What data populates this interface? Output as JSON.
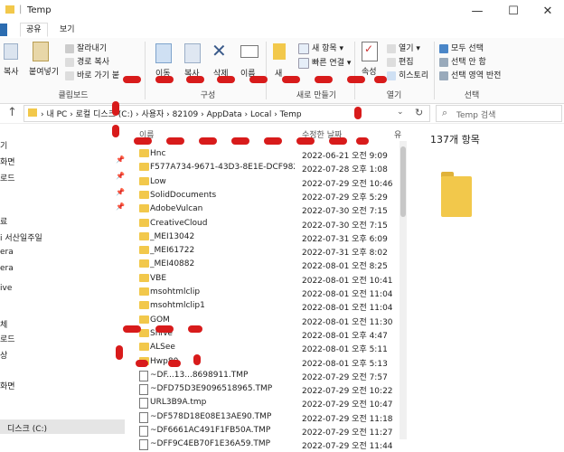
{
  "window": {
    "title": "Temp",
    "minimize": "—",
    "maximize": "☐",
    "close": "✕"
  },
  "tabs": [
    {
      "label": "공유"
    },
    {
      "label": "보기"
    }
  ],
  "ribbon": {
    "left_partial": [
      "복사",
      "붙여넣기"
    ],
    "clipboard_items": [
      "잘라내기",
      "경로 복사",
      "바로 가기 붙"
    ],
    "clipboard_label": "클립보드",
    "organize_items": [
      "이동",
      "복사",
      "삭제",
      "이름"
    ],
    "organize_label": "구성",
    "new_partial": "새",
    "new_item": "새 항목 ▾",
    "quick_access": "빠른 연결 ▾",
    "new_label": "새로 만들기",
    "properties": "속성",
    "open_items": [
      "열기 ▾",
      "편집",
      "히스토리"
    ],
    "open_label": "열기",
    "select_items": [
      "모두 선택",
      "선택 안 함",
      "선택 영역 반전"
    ],
    "select_label": "선택"
  },
  "address": {
    "path": [
      "내 PC",
      "로컬 디스크 (C:)",
      "사용자",
      "82109",
      "AppData",
      "Local",
      "Temp"
    ],
    "search_placeholder": "Temp 검색"
  },
  "nav": [
    {
      "label": "기",
      "pinned": false
    },
    {
      "label": "화면",
      "pinned": true
    },
    {
      "label": "로드",
      "pinned": true
    },
    {
      "label": "",
      "pinned": true
    },
    {
      "label": "",
      "pinned": true
    },
    {
      "label": "료",
      "pinned": false
    },
    {
      "label": "i 서산일주일",
      "pinned": false
    },
    {
      "label": "era",
      "pinned": false
    },
    {
      "label": "era",
      "pinned": false
    },
    {
      "label": "ive",
      "pinned": false
    },
    {
      "label": "체",
      "pinned": false
    },
    {
      "label": "로드",
      "pinned": false
    },
    {
      "label": "상",
      "pinned": false
    },
    {
      "label": "화면",
      "pinned": false
    },
    {
      "label": "디스크 (C:)",
      "pinned": false
    }
  ],
  "columns": {
    "name": "이름",
    "date": "수정한 날짜",
    "type": "유"
  },
  "files": [
    {
      "name": "Hnc",
      "date": "2022-06-21 오전 9:09",
      "kind": "folder"
    },
    {
      "name": "F577A734-9671-43D3-8E1E-DCF9820...",
      "date": "2022-07-28 오후 1:08",
      "kind": "folder"
    },
    {
      "name": "Low",
      "date": "2022-07-29 오전 10:46",
      "kind": "folder"
    },
    {
      "name": "SolidDocuments",
      "date": "2022-07-29 오후 5:29",
      "kind": "folder"
    },
    {
      "name": "AdobeVulcan",
      "date": "2022-07-30 오전 7:15",
      "kind": "folder"
    },
    {
      "name": "CreativeCloud",
      "date": "2022-07-30 오전 7:15",
      "kind": "folder"
    },
    {
      "name": "_MEI13042",
      "date": "2022-07-31 오후 6:09",
      "kind": "folder"
    },
    {
      "name": "_MEI61722",
      "date": "2022-07-31 오후 8:02",
      "kind": "folder"
    },
    {
      "name": "_MEI40882",
      "date": "2022-08-01 오전 8:25",
      "kind": "folder"
    },
    {
      "name": "VBE",
      "date": "2022-08-01 오전 10:41",
      "kind": "folder"
    },
    {
      "name": "msohtmlclip",
      "date": "2022-08-01 오전 11:04",
      "kind": "folder"
    },
    {
      "name": "msohtmlclip1",
      "date": "2022-08-01 오전 11:04",
      "kind": "folder"
    },
    {
      "name": "GOM",
      "date": "2022-08-01 오전 11:30",
      "kind": "folder"
    },
    {
      "name": "ShiVe",
      "date": "2022-08-01 오후 4:47",
      "kind": "folder"
    },
    {
      "name": "ALSee",
      "date": "2022-08-01 오후 5:11",
      "kind": "folder"
    },
    {
      "name": "Hwp80",
      "date": "2022-08-01 오후 5:13",
      "kind": "folder"
    },
    {
      "name": "~DF...13...8698911.TMP",
      "date": "2022-07-29 오전 7:57",
      "kind": "file"
    },
    {
      "name": "~DFD75D3E9096518965.TMP",
      "date": "2022-07-29 오전 10:22",
      "kind": "file"
    },
    {
      "name": "URL3B9A.tmp",
      "date": "2022-07-29 오전 10:47",
      "kind": "file"
    },
    {
      "name": "~DF578D18E08E13AE90.TMP",
      "date": "2022-07-29 오전 11:18",
      "kind": "file"
    },
    {
      "name": "~DF6661AC491F1FB50A.TMP",
      "date": "2022-07-29 오전 11:27",
      "kind": "file"
    },
    {
      "name": "~DFF9C4EB70F1E36A59.TMP",
      "date": "2022-07-29 오전 11:44",
      "kind": "file"
    }
  ],
  "details": {
    "count": "137개 항목"
  },
  "colors": {
    "folder": "#f2c84b",
    "annotation": "#d81b1b",
    "accent": "#2b6cb0"
  }
}
